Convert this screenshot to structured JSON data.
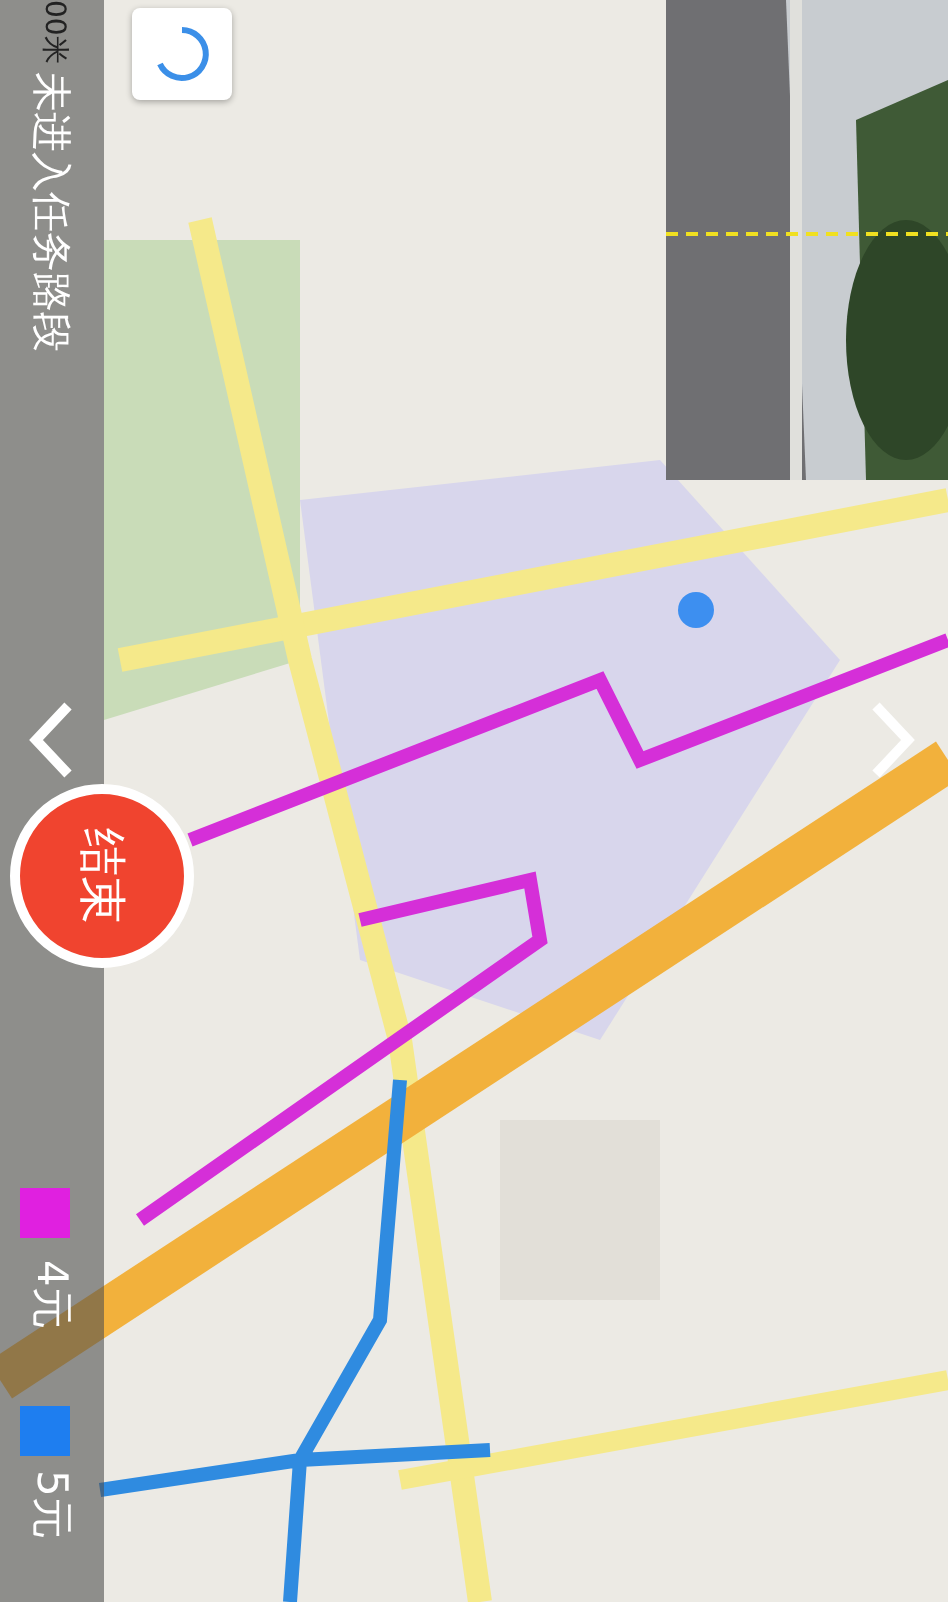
{
  "scale": {
    "text": "00米"
  },
  "status": {
    "text": "未进入任务路段"
  },
  "end_button": {
    "label": "结束"
  },
  "fares": [
    {
      "label": "4元",
      "color": "#e020e0"
    },
    {
      "label": "5元",
      "color": "#1e7ef0"
    }
  ]
}
